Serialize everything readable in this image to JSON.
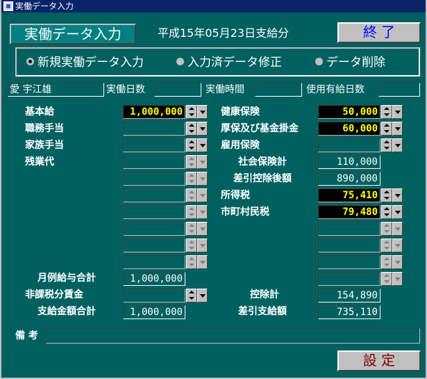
{
  "window": {
    "title": "実働データ入力"
  },
  "header": {
    "tag": "実働データ入力",
    "period": "平成15年05月23日支給分",
    "close_button": "終 了"
  },
  "modes": [
    {
      "label": "新規実働データ入力",
      "selected": true
    },
    {
      "label": "入力済データ修正",
      "selected": false
    },
    {
      "label": "データ削除",
      "selected": false
    }
  ],
  "employee": {
    "name": "愛 宇江雄",
    "work_days_label": "実働日数",
    "work_days": "",
    "work_hours_label": "実働時間",
    "work_hours": "",
    "paid_leave_label": "使用有給日数",
    "paid_leave": ""
  },
  "earnings": [
    {
      "label": "基本給",
      "value": "1,000,000"
    },
    {
      "label": "職務手当",
      "value": ""
    },
    {
      "label": "家族手当",
      "value": ""
    },
    {
      "label": "残業代",
      "value": ""
    },
    {
      "label": "",
      "value": ""
    },
    {
      "label": "",
      "value": ""
    },
    {
      "label": "",
      "value": ""
    },
    {
      "label": "",
      "value": ""
    },
    {
      "label": "",
      "value": ""
    }
  ],
  "deductions": [
    {
      "label": "健康保険",
      "value": "50,000"
    },
    {
      "label": "厚保及び基金掛金",
      "value": "60,000"
    },
    {
      "label": "雇用保険",
      "value": ""
    }
  ],
  "social_total": {
    "label": "社会保険計",
    "value": "110,000"
  },
  "after_social": {
    "label": "差引控除後額",
    "value": "890,000"
  },
  "taxes": [
    {
      "label": "所得税",
      "value": "75,410"
    },
    {
      "label": "市町村民税",
      "value": "79,480"
    }
  ],
  "monthly_total": {
    "label": "月例給与合計",
    "value": "1,000,000"
  },
  "non_taxable": {
    "label": "非課税分賃金",
    "value": ""
  },
  "pay_total": {
    "label": "支給金額合計",
    "value": "1,000,000"
  },
  "deduction_total": {
    "label": "控除計",
    "value": "154,890"
  },
  "net_pay": {
    "label": "差引支給額",
    "value": "735,110"
  },
  "memo": {
    "label": "備 考",
    "value": ""
  },
  "set_button": "設 定"
}
